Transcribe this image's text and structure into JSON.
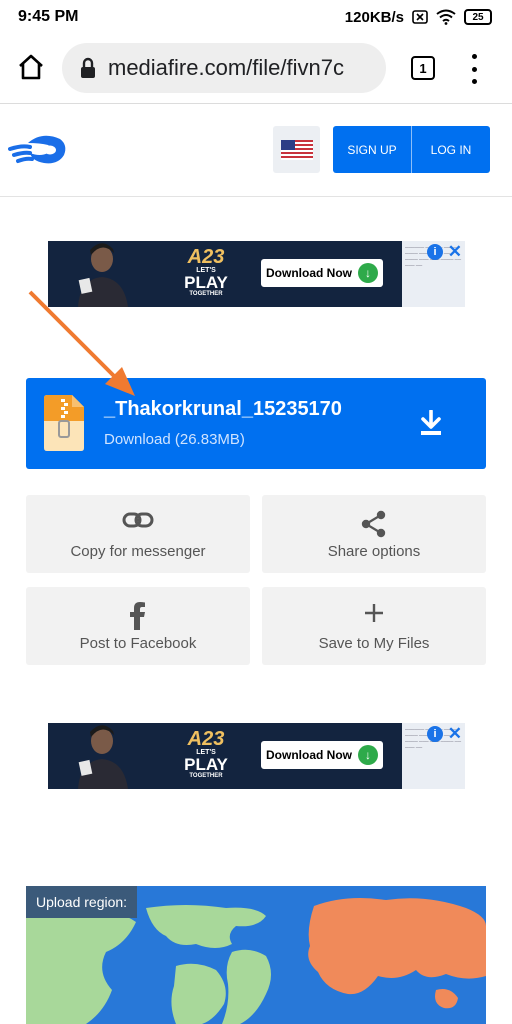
{
  "status_bar": {
    "time": "9:45 PM",
    "network_speed": "120KB/s",
    "battery": "25"
  },
  "browser": {
    "url": "mediafire.com/file/fivn7c",
    "tab_count": "1"
  },
  "header": {
    "signup_label": "SIGN UP",
    "login_label": "LOG IN",
    "brand_color": "#0070f0"
  },
  "ads": [
    {
      "brand": "A23",
      "tagline": "LET'S",
      "play": "PLAY",
      "together": "TOGETHER",
      "cta": "Download Now"
    },
    {
      "brand": "A23",
      "tagline": "LET'S",
      "play": "PLAY",
      "together": "TOGETHER",
      "cta": "Download Now"
    }
  ],
  "download": {
    "file_name": "_Thakorkrunal_15235170",
    "button_text": "Download (26.83MB)"
  },
  "actions": [
    {
      "label": "Copy for messenger",
      "icon": "link-icon"
    },
    {
      "label": "Share options",
      "icon": "share-icon"
    },
    {
      "label": "Post to Facebook",
      "icon": "facebook-icon"
    },
    {
      "label": "Save to My Files",
      "icon": "plus-icon"
    }
  ],
  "upload_region": {
    "label": "Upload region:"
  },
  "colors": {
    "annotation_arrow": "#f07a30",
    "map_water": "#2878d8",
    "map_land": "#a8d89a",
    "map_selected": "#f08a5a"
  }
}
